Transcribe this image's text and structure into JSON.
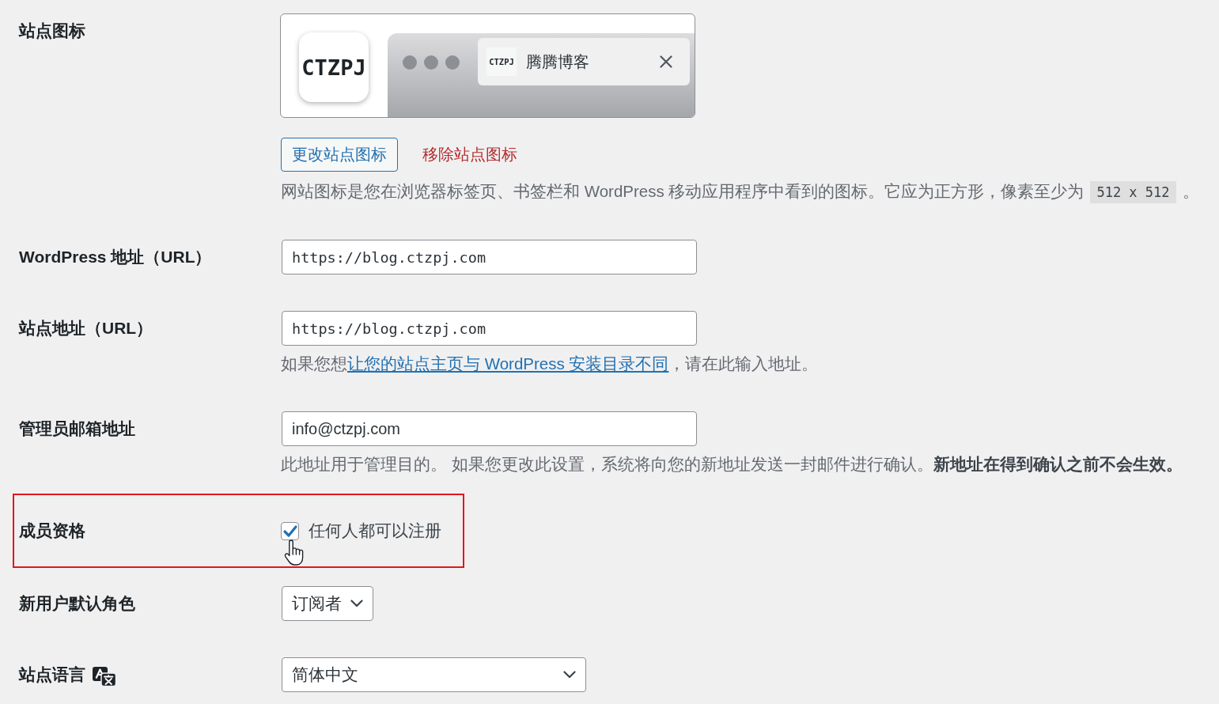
{
  "settings": [
    {
      "kind": "siteicon",
      "label": "站点图标",
      "preview": {
        "logo_text": "CTZPJ",
        "tab_logo_text": "CTZPJ",
        "tab_title": "腾腾博客"
      },
      "change_button": "更改站点图标",
      "remove_link": "移除站点图标",
      "description": {
        "text": "网站图标是您在浏览器标签页、书签栏和 WordPress 移动应用程序中看到的图标。它应为正方形，像素至少为",
        "code": "512 x 512",
        "text_after": "。"
      }
    },
    {
      "kind": "url",
      "label": "WordPress 地址（URL）",
      "value": "https://blog.ctzpj.com"
    },
    {
      "kind": "url",
      "label": "站点地址（URL）",
      "value": "https://blog.ctzpj.com",
      "description": {
        "text": "如果您想",
        "link": "让您的站点主页与 WordPress 安装目录不同",
        "text_after": "，请在此输入地址。"
      }
    },
    {
      "kind": "email",
      "label": "管理员邮箱地址",
      "value": "info@ctzpj.com",
      "description": {
        "text": "此地址用于管理目的。 如果您更改此设置，系统将向您的新地址发送一封邮件进行确认。**新地址在得到确认之前不会生效。**"
      }
    },
    {
      "kind": "checkbox",
      "label": "成员资格",
      "highlighted": true,
      "option": {
        "label": "任何人都可以注册",
        "checked": true,
        "hovered": true
      }
    },
    {
      "kind": "select",
      "label": "新用户默认角色",
      "value": "订阅者"
    },
    {
      "kind": "language",
      "label": "站点语言",
      "value": "简体中文"
    }
  ]
}
